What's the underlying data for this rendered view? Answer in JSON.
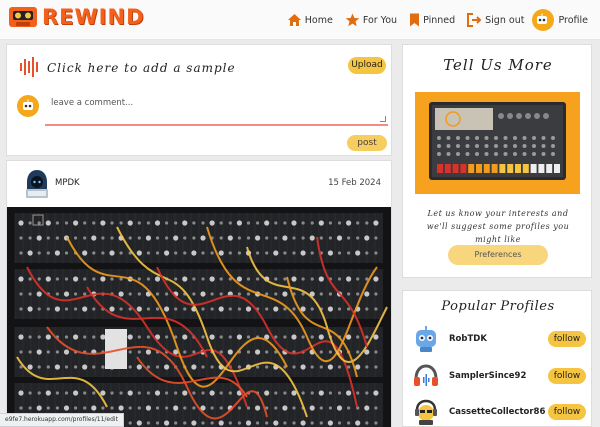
{
  "brand": {
    "name": "REWIND"
  },
  "nav": {
    "home": "Home",
    "for_you": "For You",
    "pinned": "Pinned",
    "sign_out": "Sign out",
    "profile": "Profile"
  },
  "upload": {
    "sample_label": "Click here to add a sample",
    "upload_label": "Upload",
    "comment_placeholder": "leave a comment...",
    "post_label": "post"
  },
  "post": {
    "username": "MPDK",
    "date": "15 Feb 2024"
  },
  "tell_us_more": {
    "title": "Tell Us More",
    "description": "Let us know your interests and we'll suggest some profiles you might like",
    "preferences_label": "Preferences"
  },
  "popular": {
    "title": "Popular Profiles",
    "profiles": [
      {
        "name": "RobTDK",
        "follow_label": "follow"
      },
      {
        "name": "SamplerSince92",
        "follow_label": "follow"
      },
      {
        "name": "CassetteCollector86",
        "follow_label": "follow"
      }
    ]
  },
  "status_bar": {
    "url": "e9fe7.herokuapp.com/profiles/11/edit"
  },
  "colors": {
    "accent": "#f5c542",
    "brand": "#f4601c",
    "nav_icon": "#e06d10"
  }
}
